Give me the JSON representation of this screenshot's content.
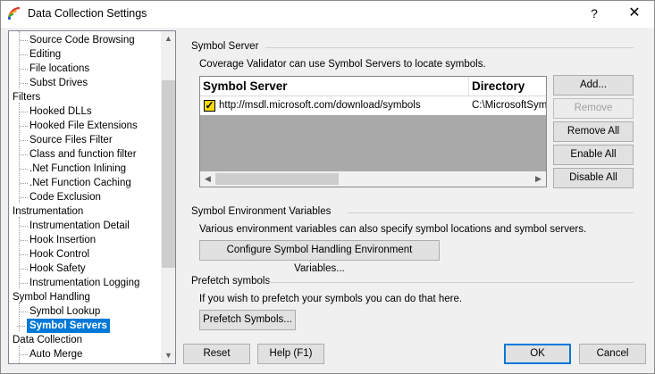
{
  "window": {
    "title": "Data Collection Settings",
    "help_label": "?",
    "close_label": "✕"
  },
  "tree": {
    "nodes": [
      {
        "label": "Source Code Browsing",
        "level": 1
      },
      {
        "label": "Editing",
        "level": 1
      },
      {
        "label": "File locations",
        "level": 1
      },
      {
        "label": "Subst Drives",
        "level": 1
      },
      {
        "label": "Filters",
        "level": 0
      },
      {
        "label": "Hooked DLLs",
        "level": 1
      },
      {
        "label": "Hooked File Extensions",
        "level": 1
      },
      {
        "label": "Source Files Filter",
        "level": 1
      },
      {
        "label": "Class and function filter",
        "level": 1
      },
      {
        "label": ".Net Function Inlining",
        "level": 1
      },
      {
        "label": ".Net Function Caching",
        "level": 1
      },
      {
        "label": "Code Exclusion",
        "level": 1
      },
      {
        "label": "Instrumentation",
        "level": 0
      },
      {
        "label": "Instrumentation Detail",
        "level": 1
      },
      {
        "label": "Hook Insertion",
        "level": 1
      },
      {
        "label": "Hook Control",
        "level": 1
      },
      {
        "label": "Hook Safety",
        "level": 1
      },
      {
        "label": "Instrumentation Logging",
        "level": 1
      },
      {
        "label": "Symbol Handling",
        "level": 0
      },
      {
        "label": "Symbol Lookup",
        "level": 1
      },
      {
        "label": "Symbol Servers",
        "level": 1,
        "selected": true
      },
      {
        "label": "Data Collection",
        "level": 0
      },
      {
        "label": "Auto Merge",
        "level": 1
      }
    ]
  },
  "symbol_server": {
    "group_title": "Symbol Server",
    "description": "Coverage Validator can use Symbol Servers to locate symbols.",
    "columns": [
      "Symbol Server",
      "Directory"
    ],
    "rows": [
      {
        "checked": true,
        "server": "http://msdl.microsoft.com/download/symbols",
        "directory": "C:\\MicrosoftSym"
      }
    ],
    "buttons": {
      "add": "Add...",
      "remove": "Remove",
      "remove_all": "Remove All",
      "enable_all": "Enable All",
      "disable_all": "Disable All"
    }
  },
  "env_vars": {
    "group_title": "Symbol Environment Variables",
    "description": "Various environment variables can also specify symbol locations and symbol servers.",
    "button": "Configure Symbol Handling Environment Variables..."
  },
  "prefetch": {
    "group_title": "Prefetch symbols",
    "description": "If you wish to prefetch your symbols you can do that here.",
    "button": "Prefetch Symbols..."
  },
  "footer": {
    "reset": "Reset",
    "help": "Help (F1)",
    "ok": "OK",
    "cancel": "Cancel"
  },
  "colors": {
    "selection": "#0078d7",
    "check_fill": "#f5d90a",
    "list_background": "#a9a9a9"
  }
}
